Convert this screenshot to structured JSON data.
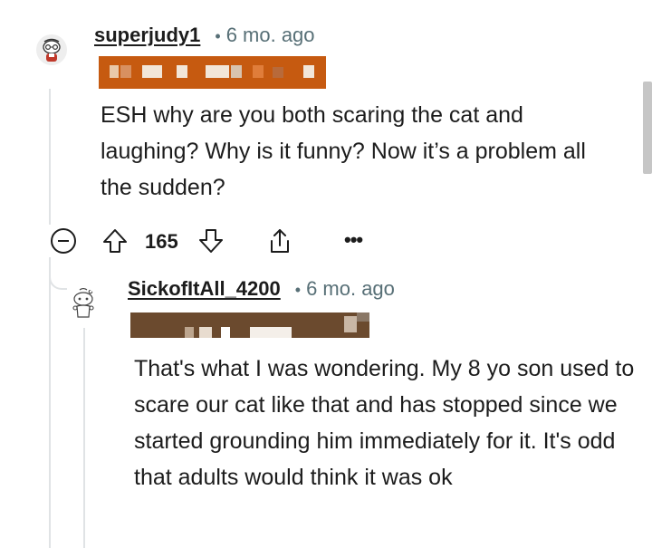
{
  "comments": [
    {
      "username": "superjudy1",
      "separator": "•",
      "timestamp": "6 mo. ago",
      "body": "ESH why are you both scaring the cat and laughing? Why is it funny? Now it’s a problem all the sudden?",
      "score": "165",
      "flair_redacted": true
    },
    {
      "username": "SickofItAll_4200",
      "separator": "•",
      "timestamp": "6 mo. ago",
      "body": "That's what I was wondering. My 8 yo son used to scare our cat like that and has stopped since we started grounding him immediately for it. It's odd that adults would think it was ok",
      "flair_redacted": true
    }
  ],
  "actions": {
    "more_label": "•••"
  },
  "icons": {
    "collapse": "minus-circle-icon",
    "upvote": "arrow-up-icon",
    "downvote": "arrow-down-icon",
    "share": "share-icon",
    "more": "more-horizontal-icon"
  },
  "colors": {
    "text": "#1c1c1c",
    "meta": "#576f76",
    "thread_line": "#e0e3e5",
    "flair_1": "#c65a10",
    "flair_2": "#6b4a2e"
  }
}
